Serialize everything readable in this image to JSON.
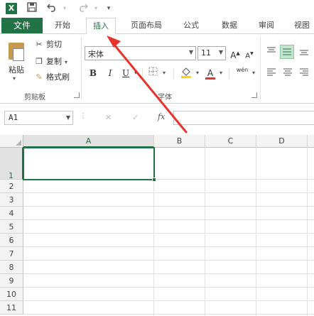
{
  "quick_access": {
    "app_logo": "X",
    "icons": [
      "save-icon",
      "undo-icon",
      "redo-icon",
      "customize-icon"
    ]
  },
  "tabs": {
    "file": "文件",
    "items": [
      "开始",
      "插入",
      "页面布局",
      "公式",
      "数据",
      "审阅",
      "视图"
    ],
    "active": "插入"
  },
  "ribbon": {
    "clipboard": {
      "paste": "粘贴",
      "cut": "剪切",
      "copy": "复制",
      "format_painter": "格式刷",
      "group_label": "剪贴板"
    },
    "font": {
      "font_name": "宋体",
      "font_size": "11",
      "bold": "B",
      "italic": "I",
      "underline": "U",
      "grow": "A",
      "shrink": "A",
      "font_color_glyph": "A",
      "phonetic_glyph": "wén",
      "group_label": "字体"
    }
  },
  "formula_bar": {
    "name_box": "A1",
    "cancel": "✕",
    "enter": "✓",
    "fx": "fx",
    "value": ""
  },
  "grid": {
    "columns": [
      "A",
      "B",
      "C",
      "D"
    ],
    "rows": [
      "1",
      "2",
      "3",
      "4",
      "5",
      "6",
      "7",
      "8",
      "9",
      "10",
      "11"
    ],
    "active_cell": "A1"
  },
  "annotation": {
    "arrow_color": "#e8322c"
  },
  "colors": {
    "accent": "#217346"
  }
}
